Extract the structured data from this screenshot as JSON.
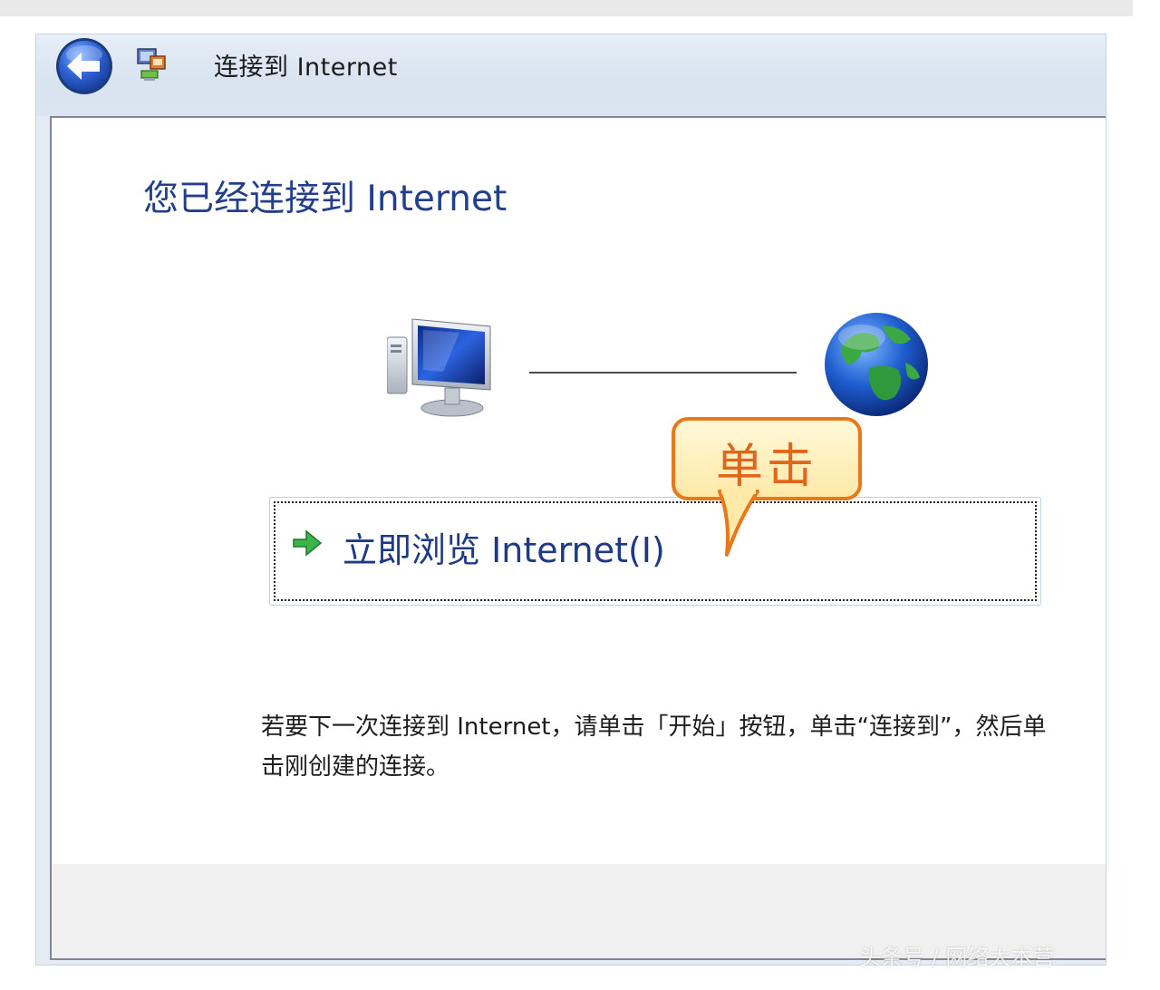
{
  "window": {
    "title": "连接到 Internet"
  },
  "content": {
    "heading": "您已经连接到 Internet",
    "browse_link_label": "立即浏览 Internet(I)",
    "instruction": "若要下一次连接到 Internet，请单击「开始」按钮，单击“连接到”，然后单击刚创建的连接。"
  },
  "annotation": {
    "callout_text": "单击",
    "callout_color": "#e8781a"
  },
  "watermark": "头条号 / 网络大本营",
  "icons": {
    "back": "back-arrow-icon",
    "app": "network-connection-icon",
    "computer": "computer-icon",
    "globe": "globe-icon",
    "link_arrow": "green-arrow-icon"
  },
  "colors": {
    "heading": "#233f8c",
    "link_text": "#1e3a85",
    "titlebar": "#dbe5f1"
  }
}
